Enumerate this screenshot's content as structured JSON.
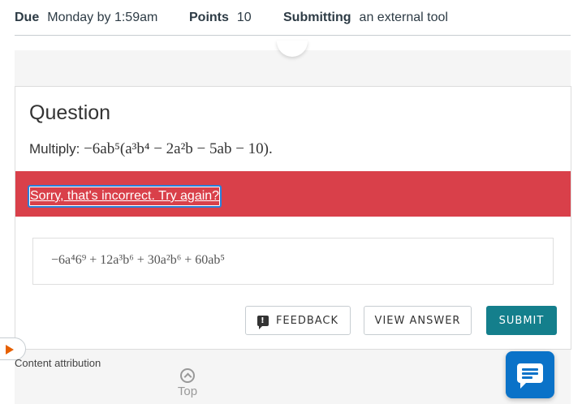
{
  "assignment": {
    "due_label": "Due",
    "due_value": "Monday by 1:59am",
    "points_label": "Points",
    "points_value": "10",
    "submitting_label": "Submitting",
    "submitting_value": "an external tool"
  },
  "question": {
    "title": "Question",
    "prompt_prefix": "Multiply:",
    "expression": "−6ab⁵(a³b⁴ − 2a²b − 5ab − 10)."
  },
  "alert": {
    "message": "Sorry, that's incorrect. Try again?",
    "color": "#d9404a"
  },
  "answer": {
    "value": "−6a⁴6⁹ + 12a³b⁶ + 30a²b⁶ + 60ab⁵"
  },
  "buttons": {
    "feedback": "FEEDBACK",
    "view_answer": "VIEW ANSWER",
    "submit": "SUBMIT",
    "submit_color": "#147f8c"
  },
  "footer": {
    "attribution": "Content attribution",
    "top": "Top"
  },
  "icons": {
    "play": "play-icon",
    "feedback": "feedback-icon",
    "top": "chevron-up-circle-icon",
    "chat": "chat-icon"
  }
}
